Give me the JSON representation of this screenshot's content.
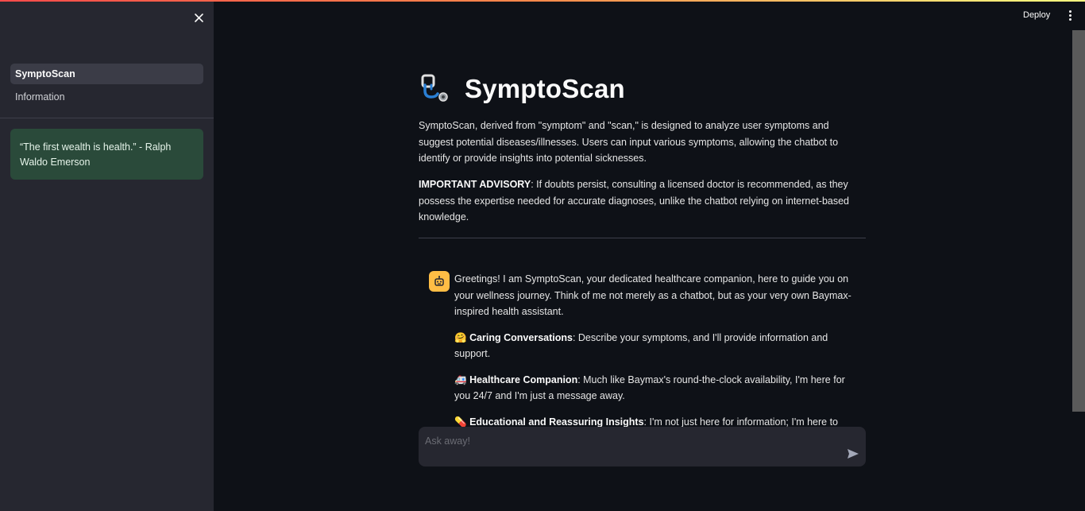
{
  "sidebar": {
    "nav": [
      {
        "label": "SymptoScan",
        "active": true
      },
      {
        "label": "Information",
        "active": false
      }
    ],
    "quote": "“The first wealth is health.” - Ralph Waldo Emerson"
  },
  "header": {
    "deploy_label": "Deploy"
  },
  "main": {
    "title": "SymptoScan",
    "intro": "SymptoScan, derived from \"symptom\" and \"scan,\" is designed to analyze user symptoms and suggest potential diseases/illnesses. Users can input various symptoms, allowing the chatbot to identify or provide insights into potential sicknesses.",
    "advisory_label": "IMPORTANT ADVISORY",
    "advisory_text": ": If doubts persist, consulting a licensed doctor is recommended, as they possess the expertise needed for accurate diagnoses, unlike the chatbot relying on internet-based knowledge."
  },
  "chat": {
    "greeting": "Greetings! I am SymptoScan, your dedicated healthcare companion, here to guide you on your wellness journey. Think of me not merely as a chatbot, but as your very own Baymax-inspired health assistant.",
    "features": [
      {
        "emoji": "🤗",
        "title": "Caring Conversations",
        "text": ": Describe your symptoms, and I'll provide information and support."
      },
      {
        "emoji": "🚑",
        "title": "Healthcare Companion",
        "text": ": Much like Baymax's round-the-clock availability, I'm here for you 24/7 and I'm just a message away."
      },
      {
        "emoji": "💊",
        "title": "Educational and Reassuring Insights",
        "text": ": I'm not just here for information; I'm here to educate"
      }
    ],
    "input_placeholder": "Ask away!"
  },
  "colors": {
    "background": "#0e1117",
    "sidebar": "#262730",
    "quote_bg": "#2a4a3a",
    "avatar": "#ffbd45"
  }
}
